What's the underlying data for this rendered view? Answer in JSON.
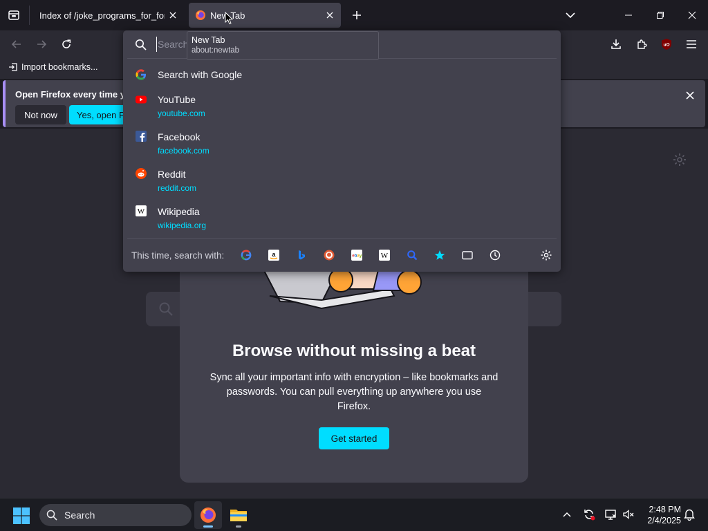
{
  "tabs": [
    {
      "title": "Index of /joke_programs_for_forkies/",
      "active": false
    },
    {
      "title": "New Tab",
      "active": true
    }
  ],
  "tooltip": {
    "title": "New Tab",
    "url": "about:newtab"
  },
  "url_bar": {
    "placeholder": "Search or enter address",
    "value": ""
  },
  "bookmarks": {
    "import_label": "Import bookmarks..."
  },
  "notification": {
    "message": "Open Firefox every time you restart your computer?",
    "secondary_label": "Not now",
    "primary_label": "Yes, open Firefox"
  },
  "suggestions": {
    "search_with": "Search with Google",
    "sites": [
      {
        "title": "YouTube",
        "url": "youtube.com",
        "icon": "youtube-icon"
      },
      {
        "title": "Facebook",
        "url": "facebook.com",
        "icon": "facebook-icon"
      },
      {
        "title": "Reddit",
        "url": "reddit.com",
        "icon": "reddit-icon"
      },
      {
        "title": "Wikipedia",
        "url": "wikipedia.org",
        "icon": "wikipedia-icon"
      }
    ]
  },
  "one_off": {
    "label": "This time, search with:",
    "engines": [
      "google-icon",
      "amazon-icon",
      "bing-icon",
      "duckduckgo-icon",
      "ebay-icon",
      "wikipedia-icon",
      "search-icon",
      "bookmarks-star-icon",
      "tabs-icon",
      "history-icon"
    ]
  },
  "sync_card": {
    "heading": "Browse without missing a beat",
    "body": "Sync all your important info with encryption – like bookmarks and passwords. You can pull everything up anywhere you use Firefox.",
    "button": "Get started"
  },
  "taskbar": {
    "search_label": "Search",
    "time": "2:48 PM",
    "date": "2/4/2025"
  },
  "colors": {
    "accent": "#00ddff",
    "page_bg": "#2b2a33",
    "panel": "#42414d"
  }
}
